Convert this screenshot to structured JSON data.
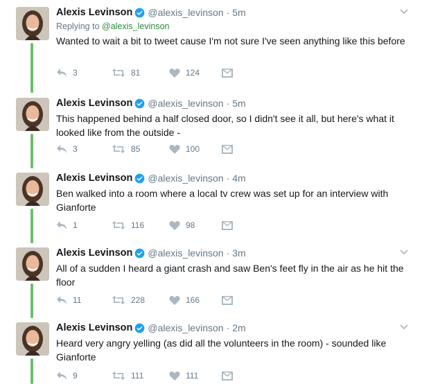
{
  "colors": {
    "accent_green": "#6abf69",
    "muted": "#657786",
    "verified": "#1da1f2",
    "icon": "#aab8c2"
  },
  "icons": {
    "reply": "reply-icon",
    "retweet": "retweet-icon",
    "like": "heart-icon",
    "dm": "envelope-icon",
    "verified": "verified-badge-icon",
    "menu": "chevron-down-icon"
  },
  "tweets": [
    {
      "name": "Alexis Levinson",
      "handle": "@alexis_levinson",
      "dot": "·",
      "time": "5m",
      "reply_prefix": "Replying to ",
      "reply_to": "@alexis_levinson",
      "text": "Wanted to wait a bit to tweet cause I'm not sure I've seen anything like this before",
      "replies": "3",
      "retweets": "81",
      "likes": "124"
    },
    {
      "name": "Alexis Levinson",
      "handle": "@alexis_levinson",
      "dot": "·",
      "time": "5m",
      "text": "This happened behind a half closed door, so I didn't see it all, but here's what it looked like from the outside -",
      "replies": "3",
      "retweets": "85",
      "likes": "100"
    },
    {
      "name": "Alexis Levinson",
      "handle": "@alexis_levinson",
      "dot": "·",
      "time": "4m",
      "text": "Ben walked into a room where a local tv crew was set up for an interview with Gianforte",
      "replies": "1",
      "retweets": "116",
      "likes": "98"
    },
    {
      "name": "Alexis Levinson",
      "handle": "@alexis_levinson",
      "dot": "·",
      "time": "3m",
      "text": "All of a sudden I heard a giant crash and saw Ben's feet fly in the air as he hit the floor",
      "replies": "11",
      "retweets": "228",
      "likes": "166"
    },
    {
      "name": "Alexis Levinson",
      "handle": "@alexis_levinson",
      "dot": "·",
      "time": "2m",
      "text": "Heard very angry yelling (as did all the volunteers in the room) - sounded like Gianforte",
      "replies": "9",
      "retweets": "111",
      "likes": "111"
    }
  ]
}
